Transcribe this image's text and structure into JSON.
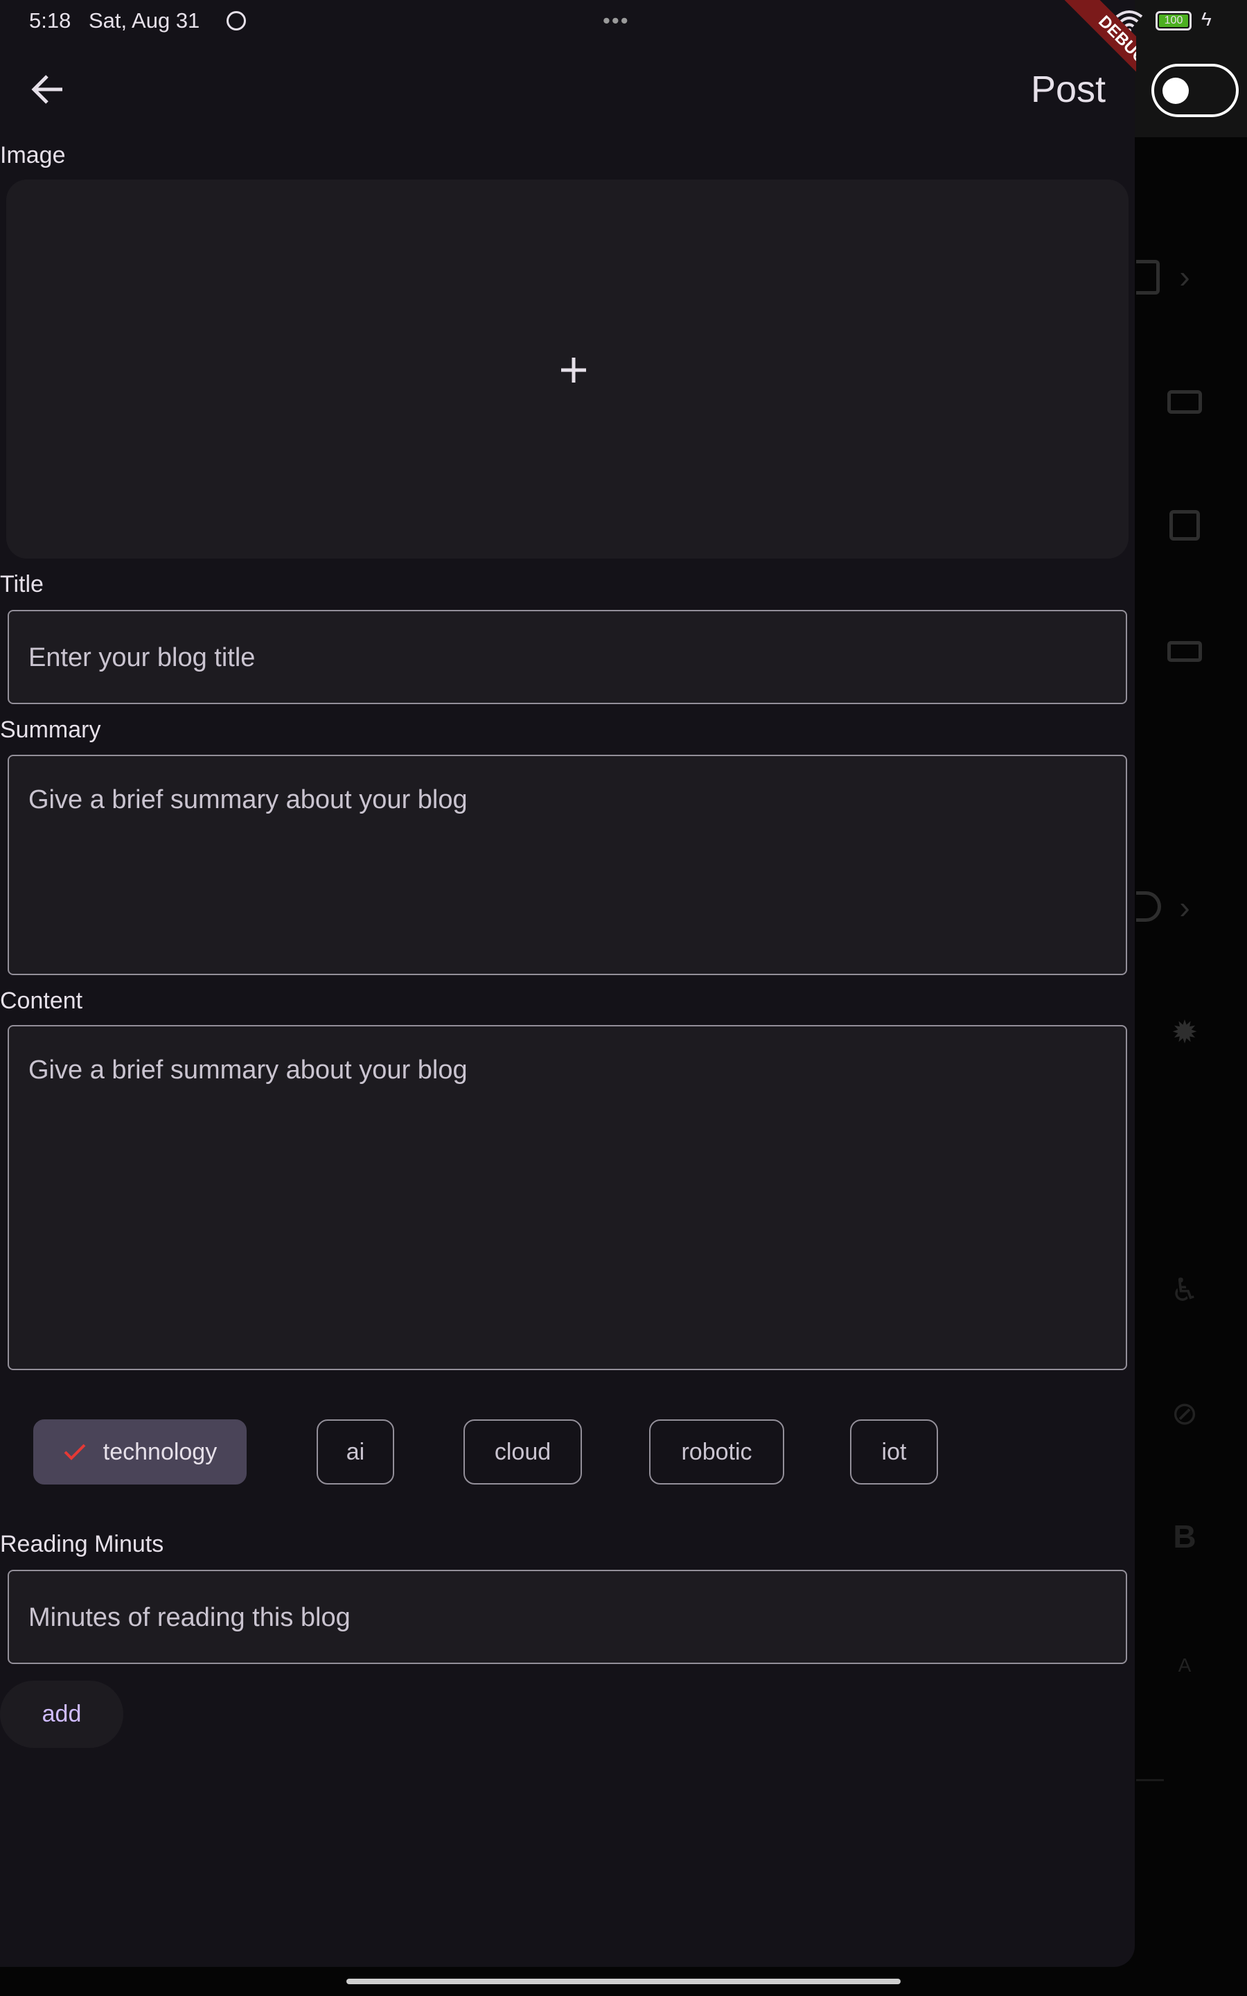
{
  "status_bar": {
    "time": "5:18",
    "date": "Sat, Aug 31",
    "battery": "100",
    "more": "•••"
  },
  "app_bar": {
    "back_icon": "arrow-left-icon",
    "post_label": "Post",
    "debug_banner": "DEBUG"
  },
  "toggle": {
    "on": false
  },
  "form": {
    "image": {
      "label": "Image",
      "icon": "plus-icon"
    },
    "title": {
      "label": "Title",
      "placeholder": "Enter your blog title"
    },
    "summary": {
      "label": "Summary",
      "placeholder": "Give a brief summary about your blog"
    },
    "content": {
      "label": "Content",
      "placeholder": "Give a brief summary about your blog"
    },
    "tags": [
      {
        "label": "technology",
        "selected": true
      },
      {
        "label": "ai",
        "selected": false
      },
      {
        "label": "cloud",
        "selected": false
      },
      {
        "label": "robotic",
        "selected": false
      },
      {
        "label": "iot",
        "selected": false
      }
    ],
    "reading": {
      "label": "Reading Minuts",
      "placeholder": "Minutes of reading this blog"
    },
    "add_label": "add"
  },
  "colors": {
    "background": "#141218",
    "field": "#1d1b20",
    "border": "#938f99",
    "chip_selected": "#4a4458",
    "accent": "#d0bcff",
    "check": "#e53935",
    "debug": "#7b1a1a"
  }
}
